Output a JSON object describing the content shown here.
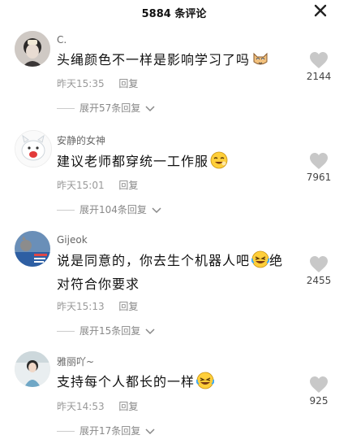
{
  "header": {
    "title": "5884 条评论"
  },
  "comments": [
    {
      "username": "C.",
      "text": "头绳颜色不一样是影响学习了吗",
      "time": "昨天15:35",
      "reply_label": "回复",
      "likes": "2144",
      "expand_label": "展开57条回复",
      "emoji": "cat-emoji"
    },
    {
      "username": "安静的女神",
      "text": "建议老师都穿统一工作服",
      "time": "昨天15:01",
      "reply_label": "回复",
      "likes": "7961",
      "expand_label": "展开104条回复",
      "emoji": "laughing-emoji"
    },
    {
      "username": "Gijeok",
      "text_line1": "说是同意的，你去生个机器人吧",
      "text_line2": "对符合你要求",
      "text_line1_tail": "绝",
      "time": "昨天15:13",
      "reply_label": "回复",
      "likes": "2455",
      "expand_label": "展开15条回复",
      "emoji": "laughing-tears-emoji"
    },
    {
      "username": "雅丽吖~",
      "text": "支持每个人都长的一样",
      "time": "昨天14:53",
      "reply_label": "回复",
      "likes": "925",
      "expand_label": "展开17条回复",
      "emoji": "laughing-tears-emoji"
    }
  ],
  "colors": {
    "heart": "#c8c8c8",
    "meta": "#999999",
    "text": "#111111"
  },
  "icons": {
    "close": "close-icon",
    "like": "heart-icon",
    "expand": "chevron-down-icon"
  }
}
